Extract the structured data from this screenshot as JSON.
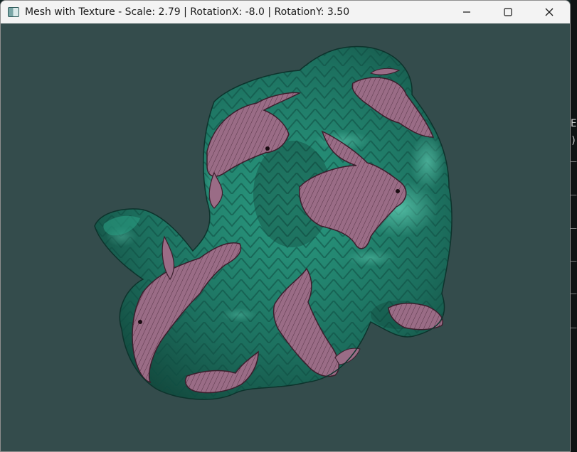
{
  "window": {
    "title": "Mesh with Texture - Scale: 2.79 | RotationX: -8.0 | RotationY: 3.50",
    "icon": "app-window-icon"
  },
  "controls": {
    "minimize_icon": "minimize-icon",
    "maximize_icon": "maximize-icon",
    "close_icon": "close-icon"
  },
  "viewport": {
    "background": "#344c4c",
    "mesh_color": "#1f7a67",
    "mesh_dark": "#123d36",
    "mesh_highlight": "#49c1a6",
    "texture_color": "#9a6c86",
    "texture_shadow": "#5b3447"
  },
  "background_terminal": {
    "lines": [
      "E",
      ")",
      "_",
      "_i",
      "_i",
      "_i",
      "_i",
      "_i"
    ]
  }
}
